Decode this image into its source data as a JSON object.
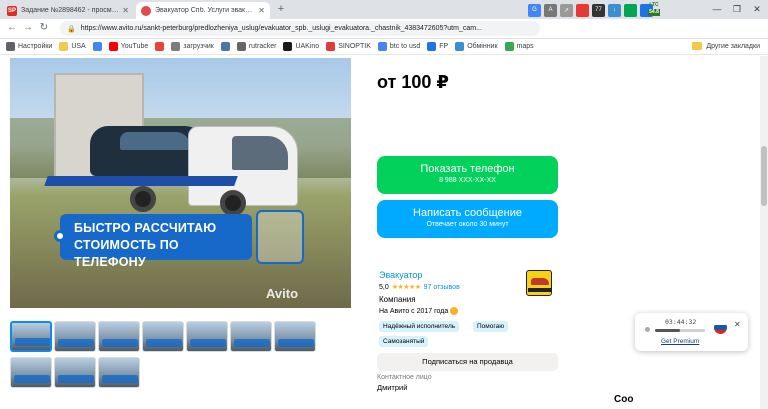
{
  "tabs": [
    {
      "label": "Задание №2898462 - просмотр з",
      "favicon": "SP",
      "color": "#d93025"
    },
    {
      "label": "Эвакуатор Спб. Услуги эвакуатор",
      "favicon": "",
      "color": "#e04b4b"
    }
  ],
  "url": "https://www.avito.ru/sankt-peterburg/predlozheniya_uslug/evakuator_spb._uslugi_evakuatora._chastnik_4383472605?utm_cam...",
  "extensions": {
    "ltc": "LTC",
    "ltc_value": "54.8"
  },
  "bookmarks": [
    {
      "label": "Настройки",
      "icon": "gear-icon",
      "color": "#5f6368"
    },
    {
      "label": "USA",
      "icon": "folder-icon",
      "color": "#f2c94c"
    },
    {
      "label": "",
      "icon": "google-icon",
      "color": "#4285f4"
    },
    {
      "label": "YouTube",
      "icon": "youtube-icon",
      "color": "#ff0000"
    },
    {
      "label": "",
      "icon": "gmail-icon",
      "color": "#ea4335"
    },
    {
      "label": "загрузчик",
      "icon": "download-icon",
      "color": "#7c7c7c"
    },
    {
      "label": "",
      "icon": "vk-icon",
      "color": "#4a76a8"
    },
    {
      "label": "rutracker",
      "icon": "rutracker-icon",
      "color": "#666666"
    },
    {
      "label": "UAKino",
      "icon": "uakino-icon",
      "color": "#1a1a1a"
    },
    {
      "label": "SINOPTIK",
      "icon": "sinoptik-icon",
      "color": "#e53935"
    },
    {
      "label": "btc to usd",
      "icon": "google-icon",
      "color": "#4285f4"
    },
    {
      "label": "FP",
      "icon": "fp-icon",
      "color": "#1a73e8"
    },
    {
      "label": "Обмінник",
      "icon": "exchange-icon",
      "color": "#3b8ed0"
    },
    {
      "label": "maps",
      "icon": "maps-icon",
      "color": "#34a853"
    }
  ],
  "other_bookmarks": "Другие закладки",
  "listing": {
    "banner_line1": "БЫСТРО РАССЧИТАЮ",
    "banner_line2": "СТОИМОСТЬ ПО ТЕЛЕФОНУ",
    "watermark": "Avito",
    "thumbnail_count": 11,
    "price": "от 100 ₽",
    "phone_button": "Показать телефон",
    "phone_masked": "8 988 XXX-XX-XX",
    "message_button": "Написать сообщение",
    "message_sub": "Отвечает около 30 минут",
    "seller_name": "Эвакуатор",
    "rating": "5,0",
    "stars": "★★★★★",
    "reviews": "97 отзывов",
    "seller_type": "Компания",
    "since": "На Авито с 2017 года",
    "badges": [
      "Надёжный исполнитель",
      "Помогаю",
      "Самозанятый"
    ],
    "subscribe": "Подписаться на продавца",
    "contact_label": "Контактное лицо",
    "contact_name": "Дмитрий",
    "cut_off_text": "Соо"
  },
  "widget": {
    "time": "03:44:32",
    "premium": "Get Premium",
    "progress": 0.5
  },
  "colors": {
    "green": "#02d15c",
    "blue": "#00aaff",
    "link": "#0096e0",
    "badge_bg": "#d6f2fc"
  }
}
